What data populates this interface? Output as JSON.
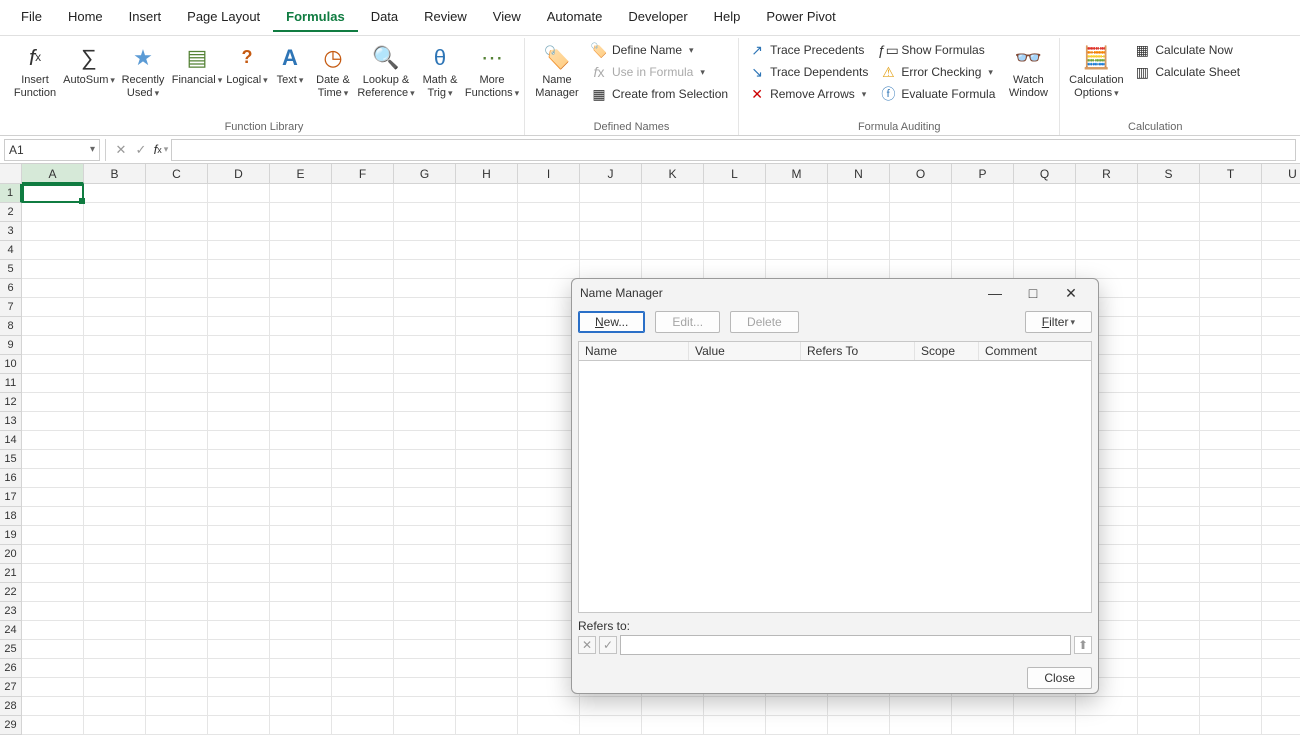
{
  "tabs": [
    "File",
    "Home",
    "Insert",
    "Page Layout",
    "Formulas",
    "Data",
    "Review",
    "View",
    "Automate",
    "Developer",
    "Help",
    "Power Pivot"
  ],
  "active_tab_index": 4,
  "ribbon": {
    "group1_label": "Function Library",
    "insert_function": "Insert\nFunction",
    "autosum": "AutoSum",
    "recently": "Recently\nUsed",
    "financial": "Financial",
    "logical": "Logical",
    "text": "Text",
    "date_time": "Date &\nTime",
    "lookup": "Lookup &\nReference",
    "math": "Math &\nTrig",
    "more": "More\nFunctions",
    "group2_label": "Defined Names",
    "name_manager": "Name\nManager",
    "define_name": "Define Name",
    "use_in_formula": "Use in Formula",
    "create_sel": "Create from Selection",
    "group3_label": "Formula Auditing",
    "trace_prec": "Trace Precedents",
    "trace_dep": "Trace Dependents",
    "remove_arrows": "Remove Arrows",
    "show_formulas": "Show Formulas",
    "error_check": "Error Checking",
    "eval_formula": "Evaluate Formula",
    "watch_window": "Watch\nWindow",
    "group4_label": "Calculation",
    "calc_opts": "Calculation\nOptions",
    "calc_now": "Calculate Now",
    "calc_sheet": "Calculate Sheet"
  },
  "namebox_value": "A1",
  "columns": [
    "A",
    "B",
    "C",
    "D",
    "E",
    "F",
    "G",
    "H",
    "I",
    "J",
    "K",
    "L",
    "M",
    "N",
    "O",
    "P",
    "Q",
    "R",
    "S",
    "T",
    "U"
  ],
  "rows": [
    1,
    2,
    3,
    4,
    5,
    6,
    7,
    8,
    9,
    10,
    11,
    12,
    13,
    14,
    15,
    16,
    17,
    18,
    19,
    20,
    21,
    22,
    23,
    24,
    25,
    26,
    27,
    28,
    29
  ],
  "dialog": {
    "title": "Name Manager",
    "new": "New...",
    "edit": "Edit...",
    "delete": "Delete",
    "filter": "Filter",
    "cols": {
      "name": "Name",
      "value": "Value",
      "refers": "Refers To",
      "scope": "Scope",
      "comment": "Comment"
    },
    "refers_to_label": "Refers to:",
    "close": "Close"
  }
}
